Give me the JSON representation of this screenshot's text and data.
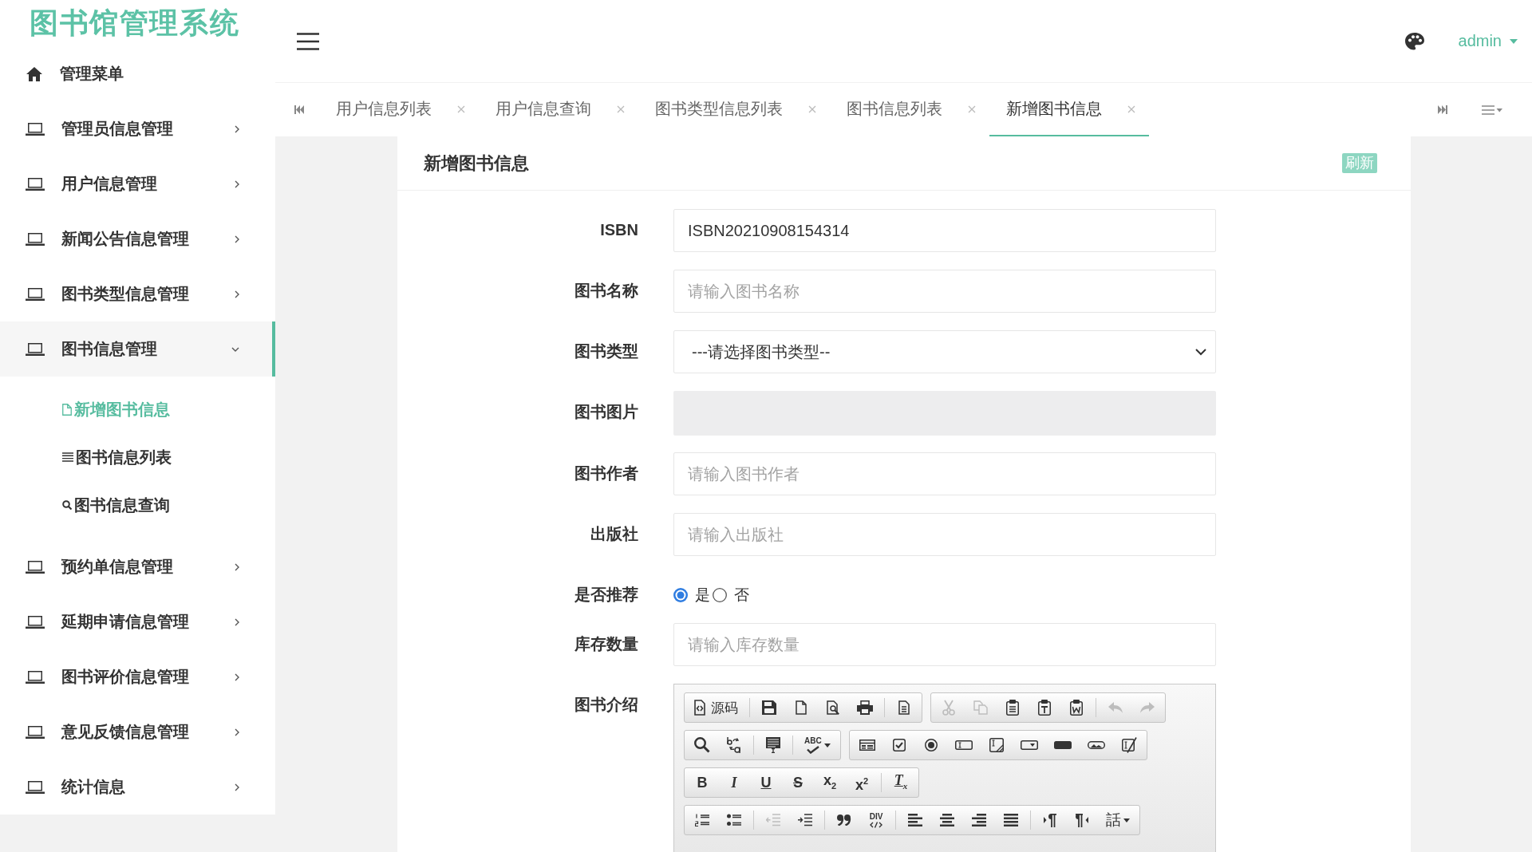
{
  "sidebar": {
    "title": "图书馆管理系统",
    "items": [
      {
        "kind": "heading",
        "label": "管理菜单",
        "selected": false
      },
      {
        "kind": "menu",
        "label": "管理员信息管理",
        "expanded": false,
        "selected": false
      },
      {
        "kind": "menu",
        "label": "用户信息管理",
        "expanded": false,
        "selected": false
      },
      {
        "kind": "menu",
        "label": "新闻公告信息管理",
        "expanded": false,
        "selected": false
      },
      {
        "kind": "menu",
        "label": "图书类型信息管理",
        "expanded": false,
        "selected": false
      },
      {
        "kind": "menu",
        "label": "图书信息管理",
        "expanded": true,
        "selected": true,
        "children": [
          {
            "label": "新增图书信息",
            "selected": true
          },
          {
            "label": "图书信息列表",
            "selected": false
          },
          {
            "label": "图书信息查询",
            "selected": false
          }
        ]
      },
      {
        "kind": "menu",
        "label": "预约单信息管理",
        "expanded": false,
        "selected": false
      },
      {
        "kind": "menu",
        "label": "延期申请信息管理",
        "expanded": false,
        "selected": false
      },
      {
        "kind": "menu",
        "label": "图书评价信息管理",
        "expanded": false,
        "selected": false
      },
      {
        "kind": "menu",
        "label": "意见反馈信息管理",
        "expanded": false,
        "selected": false
      },
      {
        "kind": "menu",
        "label": "统计信息",
        "expanded": false,
        "selected": false
      }
    ]
  },
  "header": {
    "user": "admin"
  },
  "tabs": [
    {
      "label": "用户信息列表",
      "selected": false
    },
    {
      "label": "用户信息查询",
      "selected": false
    },
    {
      "label": "图书类型信息列表",
      "selected": false
    },
    {
      "label": "图书信息列表",
      "selected": false
    },
    {
      "label": "新增图书信息",
      "selected": true
    }
  ],
  "page": {
    "title": "新增图书信息",
    "refresh_button": "刷新",
    "fields": [
      {
        "kind": "input",
        "label": "ISBN",
        "value": "ISBN20210908154314"
      },
      {
        "kind": "input",
        "label": "图书名称",
        "placeholder": "请输入图书名称"
      },
      {
        "kind": "select",
        "label": "图书类型",
        "value": "---请选择图书类型--"
      },
      {
        "kind": "image",
        "label": "图书图片"
      },
      {
        "kind": "input",
        "label": "图书作者",
        "placeholder": "请输入图书作者"
      },
      {
        "kind": "input",
        "label": "出版社",
        "placeholder": "请输入出版社"
      },
      {
        "kind": "radio",
        "label": "是否推荐",
        "options": [
          {
            "label": "是",
            "selected": true
          },
          {
            "label": "否",
            "selected": false
          }
        ]
      },
      {
        "kind": "input",
        "label": "库存数量",
        "placeholder": "请输入库存数量"
      },
      {
        "kind": "editor",
        "label": "图书介绍",
        "toolbar": [
          [
            [
              {
                "label": "源码",
                "disabled": false
              },
              {
                "disabled": false
              },
              {
                "disabled": false
              },
              {
                "disabled": false
              },
              {
                "disabled": false
              },
              {
                "disabled": false
              }
            ],
            [
              {
                "disabled": true
              },
              {
                "disabled": true
              },
              {
                "disabled": false
              },
              {
                "disabled": false
              },
              {
                "disabled": false
              },
              {
                "disabled": true
              },
              {
                "disabled": true
              }
            ]
          ],
          [
            [
              {
                "disabled": false
              },
              {
                "disabled": false
              },
              {
                "disabled": false
              },
              {
                "label": "ABC",
                "disabled": false
              }
            ],
            [
              {
                "disabled": false
              },
              {
                "disabled": false
              },
              {
                "disabled": false
              },
              {
                "disabled": false
              },
              {
                "disabled": false
              },
              {
                "disabled": false
              },
              {
                "disabled": false
              },
              {
                "disabled": false
              },
              {
                "disabled": false
              }
            ]
          ],
          [
            [
              {
                "label": "B",
                "disabled": false
              },
              {
                "label": "I",
                "disabled": false
              },
              {
                "label": "U",
                "disabled": false
              },
              {
                "label": "S",
                "disabled": false
              },
              {
                "label": "x$_{2}$",
                "disabled": false
              },
              {
                "label": "x$^{2}$",
                "disabled": false
              },
              {
                "label": "T$_{x}$",
                "disabled": false
              }
            ]
          ],
          [
            [
              {
                "disabled": false
              },
              {
                "disabled": false
              },
              {
                "disabled": true
              },
              {
                "disabled": false
              },
              {
                "disabled": false
              },
              {
                "label": "DIV",
                "disabled": false
              },
              {
                "disabled": false
              },
              {
                "disabled": false
              },
              {
                "disabled": false
              },
              {
                "disabled": false
              },
              {
                "disabled": false
              },
              {
                "disabled": false
              },
              {
                "label": "話",
                "disabled": false
              }
            ]
          ]
        ]
      }
    ]
  }
}
